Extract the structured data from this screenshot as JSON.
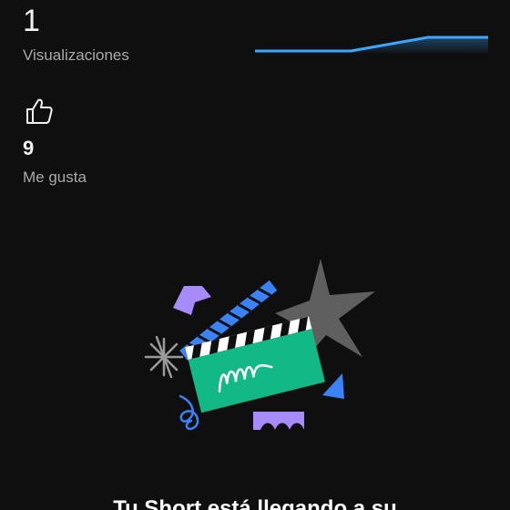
{
  "stats": {
    "views": {
      "count": "1",
      "label": "Visualizaciones",
      "trend_color": "#3ea6ff"
    },
    "likes": {
      "icon": "thumb-up-icon",
      "count": "9",
      "label": "Me gusta"
    }
  },
  "empty_state": {
    "illustration": "clapperboard-illustration",
    "title": "Tu Short está llegando a su"
  },
  "colors": {
    "background": "#0f0f0f",
    "accent_blue": "#3ea6ff",
    "clapper_green": "#12b886",
    "purple": "#a78bfa",
    "gray_star": "#606060"
  }
}
